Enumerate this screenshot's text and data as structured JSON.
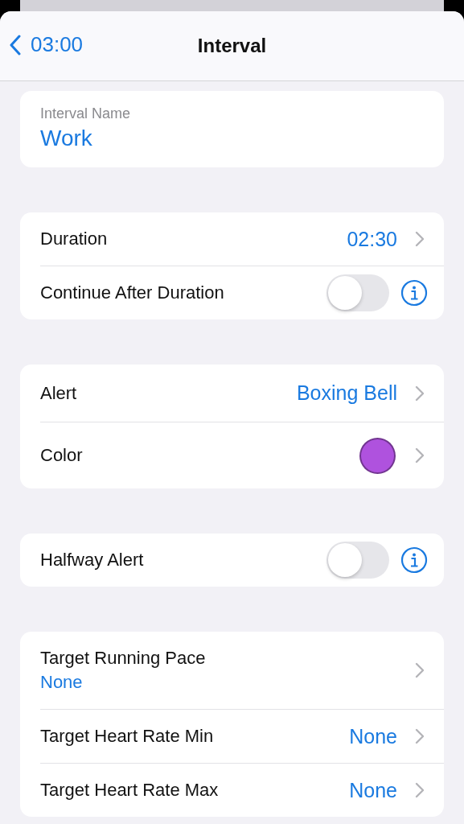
{
  "nav": {
    "back_label": "03:00",
    "title": "Interval"
  },
  "name_field": {
    "label": "Interval Name",
    "value": "Work"
  },
  "sections": [
    {
      "rows": [
        {
          "kind": "value",
          "label": "Duration",
          "value": "02:30"
        },
        {
          "kind": "toggle",
          "label": "Continue After Duration",
          "on": false
        }
      ]
    },
    {
      "rows": [
        {
          "kind": "value",
          "label": "Alert",
          "value": "Boxing Bell"
        },
        {
          "kind": "color",
          "label": "Color",
          "color": "#af52de"
        }
      ]
    },
    {
      "rows": [
        {
          "kind": "toggle",
          "label": "Halfway Alert",
          "on": false
        }
      ]
    },
    {
      "rows": [
        {
          "kind": "subvalue",
          "label": "Target Running Pace",
          "value": "None"
        },
        {
          "kind": "value",
          "label": "Target Heart Rate Min",
          "value": "None"
        },
        {
          "kind": "value",
          "label": "Target Heart Rate Max",
          "value": "None"
        }
      ]
    }
  ]
}
